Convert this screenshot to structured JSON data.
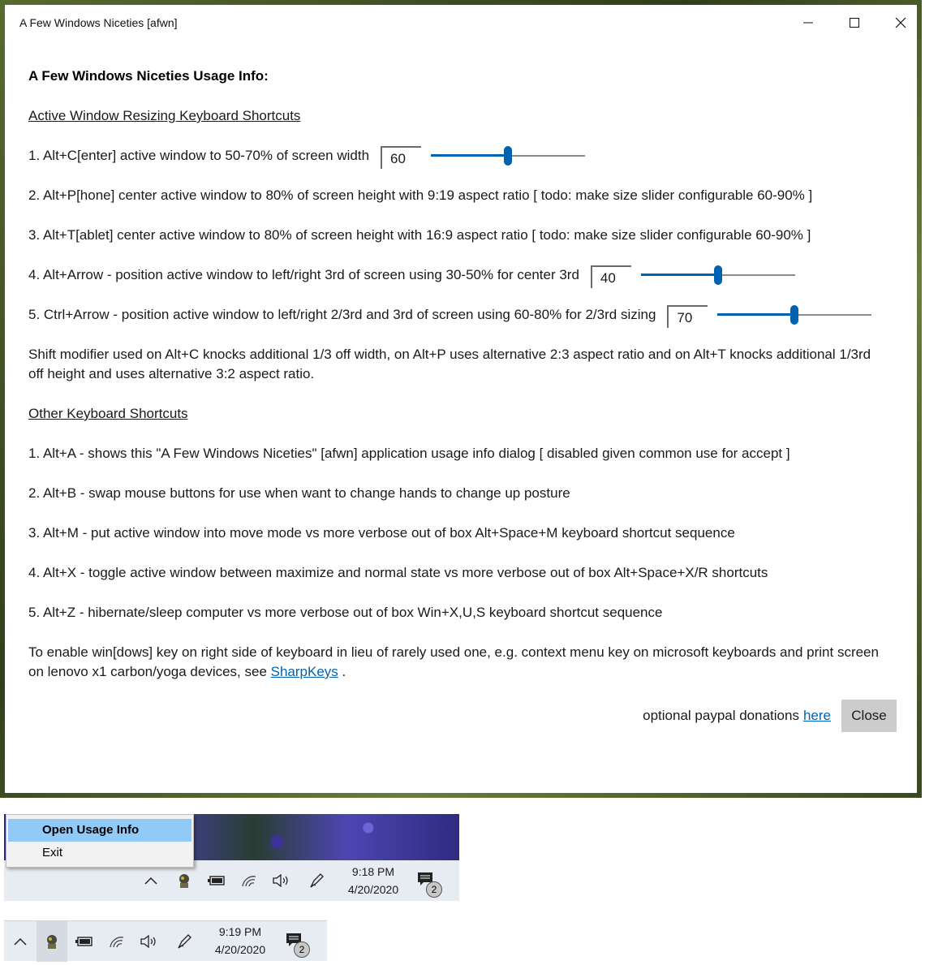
{
  "window": {
    "title": "A Few Windows Niceties [afwn]"
  },
  "content": {
    "heading": "A Few Windows Niceties Usage Info:",
    "section1_title": "Active Window Resizing Keyboard Shortcuts",
    "item1": "1. Alt+C[enter] active window to 50-70% of screen width",
    "item1_value": "60",
    "item1_slider": {
      "min": 50,
      "max": 70,
      "value": 60
    },
    "item2": "2. Alt+P[hone] center active window to 80% of screen height with 9:19 aspect ratio [ todo: make size slider configurable 60-90% ]",
    "item3": "3. Alt+T[ablet] center active window to 80% of screen height with 16:9 aspect ratio [ todo: make size slider configurable 60-90% ]",
    "item4": "4. Alt+Arrow - position active window to left/right 3rd of screen using 30-50% for center 3rd",
    "item4_value": "40",
    "item4_slider": {
      "min": 30,
      "max": 50,
      "value": 40
    },
    "item5": "5. Ctrl+Arrow - position active window to left/right 2/3rd and 3rd of screen using 60-80% for 2/3rd sizing",
    "item5_value": "70",
    "item5_slider": {
      "min": 60,
      "max": 80,
      "value": 70
    },
    "shift_note_line1": "Shift modifier used on Alt+C knocks additional 1/3 off width, on Alt+P uses alternative 2:3 aspect ratio and on Alt+T knocks additional 1/3rd",
    "shift_note_line2": "off height and uses alternative 3:2 aspect ratio.",
    "section2_title": "Other Keyboard Shortcuts",
    "other1": "1. Alt+A - shows this \"A Few Windows Niceties\" [afwn] application usage info dialog [ disabled given common use for accept ]",
    "other2": "2. Alt+B - swap mouse buttons for use when want to change hands to change up posture",
    "other3": "3. Alt+M - put active window into move mode vs more verbose out of box Alt+Space+M keyboard shortcut sequence",
    "other4": "4. Alt+X - toggle active window between maximize and normal state vs more verbose out of box Alt+Space+X/R shortcuts",
    "other5": "5. Alt+Z - hibernate/sleep computer vs more verbose out of box Win+X,U,S keyboard shortcut sequence",
    "winkey_line1": "To enable win[dows] key on right side of keyboard in lieu of rarely used one, e.g. context menu key on microsoft keyboards and print screen",
    "winkey_line2_prefix": "on lenovo x1 carbon/yoga devices, see ",
    "sharpkeys_link": "SharpKeys",
    "winkey_line2_suffix": " .",
    "donation_text": "optional paypal donations ",
    "donation_link": "here",
    "close_label": "Close"
  },
  "tray_menu": {
    "items": [
      "Open Usage Info",
      "Exit"
    ]
  },
  "taskbar1": {
    "time": "9:18 PM",
    "date": "4/20/2020",
    "notifications": "2"
  },
  "taskbar2": {
    "time": "9:19 PM",
    "date": "4/20/2020",
    "notifications": "2"
  },
  "icons": [
    "chevron-up-icon",
    "app-tray-icon",
    "battery-icon",
    "wifi-icon",
    "volume-icon",
    "pen-icon",
    "notification-icon"
  ],
  "colors": {
    "accent": "#0063b1",
    "close_button_bg": "#cccccc",
    "menu_highlight": "#91c9f7"
  }
}
